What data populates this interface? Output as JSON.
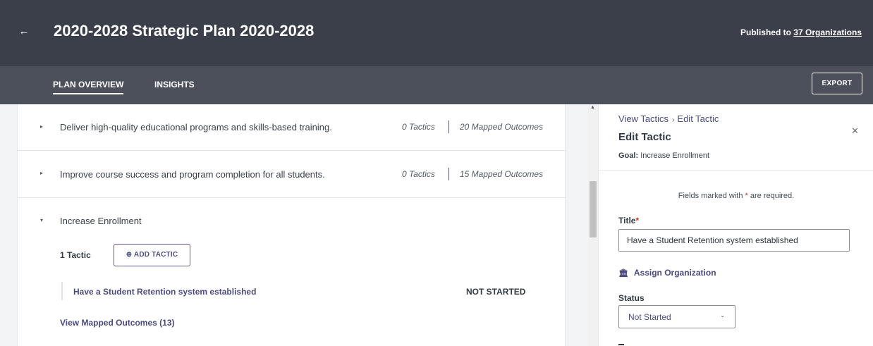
{
  "header": {
    "back_icon": "arrow-left-icon",
    "title": "2020-2028 Strategic Plan 2020-2028",
    "published_prefix": "Published to",
    "published_link": "37 Organizations"
  },
  "tabs": {
    "items": [
      {
        "label": "PLAN OVERVIEW",
        "active": true
      },
      {
        "label": "INSIGHTS",
        "active": false
      }
    ],
    "export_label": "EXPORT"
  },
  "goals": [
    {
      "text": "Deliver high-quality educational programs and skills-based training.",
      "tactics": "0 Tactics",
      "outcomes": "20 Mapped Outcomes",
      "expanded": false
    },
    {
      "text": "Improve course success and program completion for all students.",
      "tactics": "0 Tactics",
      "outcomes": "15 Mapped Outcomes",
      "expanded": false
    },
    {
      "text": "Increase Enrollment",
      "expanded": true
    }
  ],
  "expanded_goal": {
    "tactic_count": "1 Tactic",
    "add_tactic_label": "ADD TACTIC",
    "add_tactic_icon": "plus-circle-icon",
    "tactic": {
      "title": "Have a Student Retention system established",
      "status": "NOT STARTED"
    },
    "mapped_outcomes_link": "View Mapped Outcomes (13)"
  },
  "panel": {
    "breadcrumb": [
      "View Tactics",
      "Edit Tactic"
    ],
    "title": "Edit Tactic",
    "goal_label": "Goal:",
    "goal_value": "Increase Enrollment",
    "required_prefix": "Fields marked with",
    "required_star": "*",
    "required_suffix": "are required.",
    "title_label": "Title",
    "title_star": "*",
    "title_value": "Have a Student Retention system established",
    "assign_org_label": "Assign Organization",
    "assign_org_icon": "institution-icon",
    "status_label": "Status",
    "status_value": "Not Started",
    "close_icon": "close-icon"
  },
  "colors": {
    "header_bg": "#3a3f4a",
    "tabbar_bg": "#4b505b",
    "accent": "#4a4b80",
    "required": "#c0392b"
  }
}
